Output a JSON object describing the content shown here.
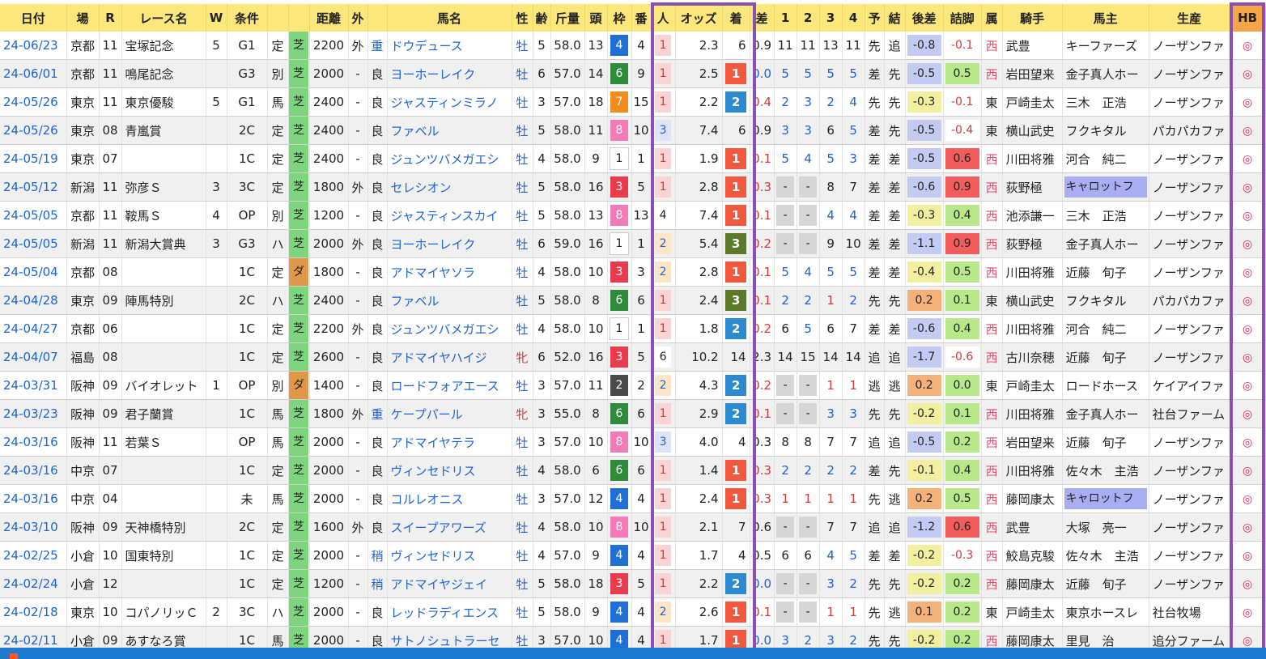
{
  "colors": {
    "header_bg": "#fbe77c",
    "alt_row": "#f0f0f0",
    "link": "#1a64d6",
    "highlight_border": "#8a4fb2",
    "hb_header": "#f4a648",
    "bottom_bar": "#1e7ad0",
    "result_1": "#f2583e",
    "result_2": "#2b8ad0",
    "result_3": "#5a7a2a",
    "turf": "#7dd67d",
    "dirt": "#e0974a",
    "frames": {
      "1": "#ffffff",
      "2": "#4a4a4a",
      "3": "#ea3b4c",
      "4": "#1e6fd6",
      "5": "#f2e64a",
      "6": "#2e8b3a",
      "7": "#f48c1d",
      "8": "#f47ab8"
    }
  },
  "headers": [
    "日付",
    "場",
    "R",
    "レース名",
    "W",
    "条件",
    "",
    "",
    "距離",
    "外",
    "",
    "馬名",
    "性",
    "齢",
    "斤量",
    "頭",
    "枠",
    "番",
    "人",
    "オッズ",
    "着",
    "差",
    "1",
    "2",
    "3",
    "4",
    "予",
    "結",
    "後差",
    "詰脚",
    "属",
    "騎手",
    "馬主",
    "生産",
    "HB"
  ],
  "rows": [
    {
      "date": "24-06/23",
      "place": "京都",
      "r": "11",
      "race": "宝塚記念",
      "w": "5",
      "cls": "G1",
      "cond": "定",
      "track": "芝",
      "dist": "2200",
      "out": "外",
      "going": "重",
      "horse": "ドウデュース",
      "sex": "牡",
      "age": "5",
      "wt": "58.0",
      "heads": "13",
      "frame": "4",
      "num": "4",
      "pop": "1",
      "odds": "2.3",
      "res": "6",
      "diff": "0.9",
      "c1": "11",
      "c2": "11",
      "c3": "13",
      "c4": "11",
      "pred": "先",
      "kekka": "追",
      "kosa": "-0.8",
      "tsume": "-0.1",
      "zoku": "西",
      "jockey": "武豊",
      "owner": "キーファーズ",
      "breeder": "ノーザンファ",
      "hb": "◎"
    },
    {
      "date": "24-06/01",
      "place": "京都",
      "r": "11",
      "race": "鳴尾記念",
      "w": "",
      "cls": "G3",
      "cond": "別",
      "track": "芝",
      "dist": "2000",
      "out": "-",
      "going": "良",
      "horse": "ヨーホーレイク",
      "sex": "牡",
      "age": "6",
      "wt": "57.0",
      "heads": "14",
      "frame": "6",
      "num": "9",
      "pop": "1",
      "odds": "2.5",
      "res": "1",
      "diff": "0.0",
      "c1": "5",
      "c2": "5",
      "c3": "5",
      "c4": "5",
      "pred": "差",
      "kekka": "先",
      "kosa": "-0.5",
      "tsume": "0.5",
      "zoku": "西",
      "jockey": "岩田望来",
      "owner": "金子真人ホー",
      "breeder": "ノーザンファ",
      "hb": "◎"
    },
    {
      "date": "24-05/26",
      "place": "東京",
      "r": "11",
      "race": "東京優駿",
      "w": "5",
      "cls": "G1",
      "cond": "馬",
      "track": "芝",
      "dist": "2400",
      "out": "-",
      "going": "良",
      "horse": "ジャスティンミラノ",
      "sex": "牡",
      "age": "3",
      "wt": "57.0",
      "heads": "18",
      "frame": "7",
      "num": "15",
      "pop": "1",
      "odds": "2.2",
      "res": "2",
      "diff": "0.4",
      "c1": "2",
      "c2": "3",
      "c3": "2",
      "c4": "4",
      "pred": "先",
      "kekka": "先",
      "kosa": "-0.3",
      "tsume": "-0.1",
      "zoku": "東",
      "jockey": "戸崎圭太",
      "owner": "三木　正浩",
      "breeder": "ノーザンファ",
      "hb": "◎"
    },
    {
      "date": "24-05/26",
      "place": "東京",
      "r": "08",
      "race": "青嵐賞",
      "w": "",
      "cls": "2C",
      "cond": "定",
      "track": "芝",
      "dist": "2400",
      "out": "-",
      "going": "良",
      "horse": "ファベル",
      "sex": "牡",
      "age": "5",
      "wt": "58.0",
      "heads": "11",
      "frame": "8",
      "num": "10",
      "pop": "3",
      "odds": "7.4",
      "res": "6",
      "diff": "0.9",
      "c1": "3",
      "c2": "3",
      "c3": "6",
      "c4": "5",
      "pred": "差",
      "kekka": "先",
      "kosa": "-0.5",
      "tsume": "-0.4",
      "zoku": "東",
      "jockey": "横山武史",
      "owner": "フクキタル",
      "breeder": "パカパカファ",
      "hb": "◎"
    },
    {
      "date": "24-05/19",
      "place": "東京",
      "r": "07",
      "race": "",
      "w": "",
      "cls": "1C",
      "cond": "定",
      "track": "芝",
      "dist": "2400",
      "out": "-",
      "going": "良",
      "horse": "ジュンツバメガエシ",
      "sex": "牡",
      "age": "4",
      "wt": "58.0",
      "heads": "9",
      "frame": "1",
      "num": "1",
      "pop": "1",
      "odds": "1.9",
      "res": "1",
      "diff": "0.1",
      "c1": "5",
      "c2": "4",
      "c3": "5",
      "c4": "3",
      "pred": "差",
      "kekka": "差",
      "kosa": "-0.5",
      "tsume": "0.6",
      "zoku": "西",
      "jockey": "川田将雅",
      "owner": "河合　純二",
      "breeder": "ノーザンファ",
      "hb": "◎"
    },
    {
      "date": "24-05/12",
      "place": "新潟",
      "r": "11",
      "race": "弥彦Ｓ",
      "w": "3",
      "cls": "3C",
      "cond": "定",
      "track": "芝",
      "dist": "1800",
      "out": "外",
      "going": "良",
      "horse": "セレシオン",
      "sex": "牡",
      "age": "5",
      "wt": "58.0",
      "heads": "16",
      "frame": "3",
      "num": "5",
      "pop": "1",
      "odds": "2.8",
      "res": "1",
      "diff": "0.3",
      "c1": "-",
      "c2": "-",
      "c3": "8",
      "c4": "7",
      "pred": "差",
      "kekka": "差",
      "kosa": "-0.6",
      "tsume": "0.9",
      "zoku": "西",
      "jockey": "荻野極",
      "owner": "キャロットフ",
      "breeder": "ノーザンファ",
      "hb": "◎"
    },
    {
      "date": "24-05/05",
      "place": "京都",
      "r": "11",
      "race": "鞍馬Ｓ",
      "w": "4",
      "cls": "OP",
      "cond": "別",
      "track": "芝",
      "dist": "1200",
      "out": "-",
      "going": "良",
      "horse": "ジャスティンスカイ",
      "sex": "牡",
      "age": "5",
      "wt": "58.0",
      "heads": "13",
      "frame": "8",
      "num": "13",
      "pop": "4",
      "odds": "7.4",
      "res": "1",
      "diff": "0.1",
      "c1": "-",
      "c2": "-",
      "c3": "4",
      "c4": "4",
      "pred": "差",
      "kekka": "差",
      "kosa": "-0.3",
      "tsume": "0.4",
      "zoku": "西",
      "jockey": "池添謙一",
      "owner": "三木　正浩",
      "breeder": "ノーザンファ",
      "hb": "◎"
    },
    {
      "date": "24-05/05",
      "place": "新潟",
      "r": "11",
      "race": "新潟大賞典",
      "w": "3",
      "cls": "G3",
      "cond": "ハ",
      "track": "芝",
      "dist": "2000",
      "out": "外",
      "going": "良",
      "horse": "ヨーホーレイク",
      "sex": "牡",
      "age": "6",
      "wt": "59.0",
      "heads": "16",
      "frame": "1",
      "num": "1",
      "pop": "2",
      "odds": "5.4",
      "res": "3",
      "diff": "0.2",
      "c1": "-",
      "c2": "-",
      "c3": "9",
      "c4": "10",
      "pred": "差",
      "kekka": "差",
      "kosa": "-1.1",
      "tsume": "0.9",
      "zoku": "西",
      "jockey": "荻野極",
      "owner": "金子真人ホー",
      "breeder": "ノーザンファ",
      "hb": "◎"
    },
    {
      "date": "24-05/04",
      "place": "京都",
      "r": "08",
      "race": "",
      "w": "",
      "cls": "1C",
      "cond": "定",
      "track": "ダ",
      "dist": "1800",
      "out": "-",
      "going": "良",
      "horse": "アドマイヤソラ",
      "sex": "牡",
      "age": "4",
      "wt": "58.0",
      "heads": "10",
      "frame": "3",
      "num": "3",
      "pop": "2",
      "odds": "2.8",
      "res": "1",
      "diff": "0.1",
      "c1": "5",
      "c2": "4",
      "c3": "5",
      "c4": "5",
      "pred": "差",
      "kekka": "差",
      "kosa": "-0.4",
      "tsume": "0.5",
      "zoku": "西",
      "jockey": "川田将雅",
      "owner": "近藤　旬子",
      "breeder": "ノーザンファ",
      "hb": "◎"
    },
    {
      "date": "24-04/28",
      "place": "東京",
      "r": "09",
      "race": "陣馬特別",
      "w": "",
      "cls": "2C",
      "cond": "ハ",
      "track": "芝",
      "dist": "2400",
      "out": "-",
      "going": "良",
      "horse": "ファベル",
      "sex": "牡",
      "age": "5",
      "wt": "58.0",
      "heads": "8",
      "frame": "6",
      "num": "6",
      "pop": "1",
      "odds": "2.4",
      "res": "3",
      "diff": "0.1",
      "c1": "2",
      "c2": "2",
      "c3": "1",
      "c4": "2",
      "pred": "先",
      "kekka": "先",
      "kosa": "0.2",
      "tsume": "0.1",
      "zoku": "東",
      "jockey": "横山武史",
      "owner": "フクキタル",
      "breeder": "パカパカファ",
      "hb": "◎"
    },
    {
      "date": "24-04/27",
      "place": "京都",
      "r": "06",
      "race": "",
      "w": "",
      "cls": "1C",
      "cond": "定",
      "track": "芝",
      "dist": "2200",
      "out": "外",
      "going": "良",
      "horse": "ジュンツバメガエシ",
      "sex": "牡",
      "age": "4",
      "wt": "58.0",
      "heads": "10",
      "frame": "1",
      "num": "1",
      "pop": "1",
      "odds": "1.8",
      "res": "2",
      "diff": "0.2",
      "c1": "6",
      "c2": "5",
      "c3": "6",
      "c4": "7",
      "pred": "差",
      "kekka": "差",
      "kosa": "-0.6",
      "tsume": "0.4",
      "zoku": "西",
      "jockey": "川田将雅",
      "owner": "河合　純二",
      "breeder": "ノーザンファ",
      "hb": "◎"
    },
    {
      "date": "24-04/07",
      "place": "福島",
      "r": "08",
      "race": "",
      "w": "",
      "cls": "1C",
      "cond": "定",
      "track": "芝",
      "dist": "2600",
      "out": "-",
      "going": "良",
      "horse": "アドマイヤハイジ",
      "sex": "牝",
      "age": "6",
      "wt": "52.0",
      "heads": "16",
      "frame": "3",
      "num": "5",
      "pop": "6",
      "odds": "10.2",
      "res": "14",
      "diff": "2.3",
      "c1": "14",
      "c2": "15",
      "c3": "14",
      "c4": "14",
      "pred": "追",
      "kekka": "追",
      "kosa": "-1.7",
      "tsume": "-0.6",
      "zoku": "西",
      "jockey": "古川奈穂",
      "owner": "近藤　旬子",
      "breeder": "ノーザンファ",
      "hb": "◎"
    },
    {
      "date": "24-03/31",
      "place": "阪神",
      "r": "09",
      "race": "バイオレット",
      "w": "1",
      "cls": "OP",
      "cond": "別",
      "track": "ダ",
      "dist": "1400",
      "out": "-",
      "going": "良",
      "horse": "ロードフォアエース",
      "sex": "牡",
      "age": "3",
      "wt": "57.0",
      "heads": "11",
      "frame": "2",
      "num": "2",
      "pop": "2",
      "odds": "4.3",
      "res": "2",
      "diff": "0.2",
      "c1": "-",
      "c2": "-",
      "c3": "1",
      "c4": "1",
      "pred": "逃",
      "kekka": "逃",
      "kosa": "0.2",
      "tsume": "0.0",
      "zoku": "東",
      "jockey": "戸崎圭太",
      "owner": "ロードホース",
      "breeder": "ケイアイファ",
      "hb": "◎"
    },
    {
      "date": "24-03/23",
      "place": "阪神",
      "r": "09",
      "race": "君子蘭賞",
      "w": "",
      "cls": "1C",
      "cond": "馬",
      "track": "芝",
      "dist": "1800",
      "out": "外",
      "going": "重",
      "horse": "ケープパール",
      "sex": "牝",
      "age": "3",
      "wt": "55.0",
      "heads": "8",
      "frame": "6",
      "num": "6",
      "pop": "1",
      "odds": "2.9",
      "res": "2",
      "diff": "0.1",
      "c1": "-",
      "c2": "-",
      "c3": "3",
      "c4": "3",
      "pred": "先",
      "kekka": "先",
      "kosa": "-0.2",
      "tsume": "0.1",
      "zoku": "西",
      "jockey": "川田将雅",
      "owner": "金子真人ホー",
      "breeder": "社台ファーム",
      "hb": "◎"
    },
    {
      "date": "24-03/16",
      "place": "阪神",
      "r": "11",
      "race": "若葉Ｓ",
      "w": "",
      "cls": "OP",
      "cond": "馬",
      "track": "芝",
      "dist": "2000",
      "out": "-",
      "going": "良",
      "horse": "アドマイヤテラ",
      "sex": "牡",
      "age": "3",
      "wt": "57.0",
      "heads": "10",
      "frame": "8",
      "num": "10",
      "pop": "3",
      "odds": "4.0",
      "res": "4",
      "diff": "0.3",
      "c1": "8",
      "c2": "8",
      "c3": "7",
      "c4": "7",
      "pred": "追",
      "kekka": "追",
      "kosa": "-0.5",
      "tsume": "0.2",
      "zoku": "西",
      "jockey": "岩田望来",
      "owner": "近藤　旬子",
      "breeder": "ノーザンファ",
      "hb": "◎"
    },
    {
      "date": "24-03/16",
      "place": "中京",
      "r": "07",
      "race": "",
      "w": "",
      "cls": "1C",
      "cond": "定",
      "track": "芝",
      "dist": "2000",
      "out": "-",
      "going": "良",
      "horse": "ヴィンセドリス",
      "sex": "牡",
      "age": "4",
      "wt": "58.0",
      "heads": "6",
      "frame": "6",
      "num": "6",
      "pop": "1",
      "odds": "1.4",
      "res": "1",
      "diff": "0.3",
      "c1": "2",
      "c2": "2",
      "c3": "2",
      "c4": "2",
      "pred": "差",
      "kekka": "先",
      "kosa": "-0.1",
      "tsume": "0.4",
      "zoku": "西",
      "jockey": "川田将雅",
      "owner": "佐々木　主浩",
      "breeder": "ノーザンファ",
      "hb": "◎"
    },
    {
      "date": "24-03/16",
      "place": "中京",
      "r": "04",
      "race": "",
      "w": "",
      "cls": "未",
      "cond": "馬",
      "track": "芝",
      "dist": "2000",
      "out": "-",
      "going": "良",
      "horse": "コルレオニス",
      "sex": "牡",
      "age": "3",
      "wt": "57.0",
      "heads": "12",
      "frame": "4",
      "num": "4",
      "pop": "1",
      "odds": "2.4",
      "res": "1",
      "diff": "0.3",
      "c1": "1",
      "c2": "1",
      "c3": "1",
      "c4": "1",
      "pred": "先",
      "kekka": "逃",
      "kosa": "0.2",
      "tsume": "0.5",
      "zoku": "西",
      "jockey": "藤岡康太",
      "owner": "キャロットフ",
      "breeder": "ノーザンファ",
      "hb": "◎"
    },
    {
      "date": "24-03/10",
      "place": "阪神",
      "r": "09",
      "race": "天神橋特別",
      "w": "",
      "cls": "2C",
      "cond": "定",
      "track": "芝",
      "dist": "1600",
      "out": "外",
      "going": "良",
      "horse": "スイープアワーズ",
      "sex": "牡",
      "age": "4",
      "wt": "58.0",
      "heads": "10",
      "frame": "8",
      "num": "10",
      "pop": "1",
      "odds": "2.1",
      "res": "7",
      "diff": "0.6",
      "c1": "-",
      "c2": "-",
      "c3": "7",
      "c4": "7",
      "pred": "追",
      "kekka": "追",
      "kosa": "-1.2",
      "tsume": "0.6",
      "zoku": "西",
      "jockey": "武豊",
      "owner": "大塚　亮一",
      "breeder": "ノーザンファ",
      "hb": "◎"
    },
    {
      "date": "24-02/25",
      "place": "小倉",
      "r": "10",
      "race": "国東特別",
      "w": "",
      "cls": "1C",
      "cond": "定",
      "track": "芝",
      "dist": "2000",
      "out": "-",
      "going": "稍",
      "horse": "ヴィンセドリス",
      "sex": "牡",
      "age": "4",
      "wt": "57.0",
      "heads": "9",
      "frame": "4",
      "num": "4",
      "pop": "1",
      "odds": "1.7",
      "res": "4",
      "diff": "0.5",
      "c1": "6",
      "c2": "6",
      "c3": "4",
      "c4": "5",
      "pred": "差",
      "kekka": "差",
      "kosa": "-0.2",
      "tsume": "-0.3",
      "zoku": "西",
      "jockey": "鮫島克駿",
      "owner": "佐々木　主浩",
      "breeder": "ノーザンファ",
      "hb": "◎"
    },
    {
      "date": "24-02/24",
      "place": "小倉",
      "r": "12",
      "race": "",
      "w": "",
      "cls": "1C",
      "cond": "定",
      "track": "芝",
      "dist": "1200",
      "out": "-",
      "going": "稍",
      "horse": "アドマイヤジェイ",
      "sex": "牡",
      "age": "5",
      "wt": "58.0",
      "heads": "18",
      "frame": "3",
      "num": "5",
      "pop": "1",
      "odds": "2.2",
      "res": "2",
      "diff": "0.0",
      "c1": "-",
      "c2": "-",
      "c3": "3",
      "c4": "2",
      "pred": "先",
      "kekka": "先",
      "kosa": "-0.2",
      "tsume": "0.2",
      "zoku": "西",
      "jockey": "藤岡康太",
      "owner": "近藤　旬子",
      "breeder": "ノーザンファ",
      "hb": "◎"
    },
    {
      "date": "24-02/18",
      "place": "東京",
      "r": "10",
      "race": "コパノリッ​Ｃ",
      "w": "2",
      "cls": "3C",
      "cond": "ハ",
      "track": "芝",
      "dist": "2000",
      "out": "-",
      "going": "良",
      "horse": "レッドラディエンス",
      "sex": "牡",
      "age": "5",
      "wt": "58.0",
      "heads": "9",
      "frame": "4",
      "num": "4",
      "pop": "2",
      "odds": "2.6",
      "res": "1",
      "diff": "0.1",
      "c1": "-",
      "c2": "-",
      "c3": "1",
      "c4": "1",
      "pred": "先",
      "kekka": "逃",
      "kosa": "0.1",
      "tsume": "0.2",
      "zoku": "東",
      "jockey": "戸崎圭太",
      "owner": "東京ホースレ",
      "breeder": "社台牧場",
      "hb": "◎"
    },
    {
      "date": "24-02/11",
      "place": "小倉",
      "r": "09",
      "race": "あすなろ賞",
      "w": "",
      "cls": "1C",
      "cond": "馬",
      "track": "芝",
      "dist": "2000",
      "out": "-",
      "going": "良",
      "horse": "サトノシュトラーセ",
      "sex": "牡",
      "age": "3",
      "wt": "57.0",
      "heads": "10",
      "frame": "4",
      "num": "4",
      "pop": "1",
      "odds": "1.7",
      "res": "1",
      "diff": "0.0",
      "c1": "3",
      "c2": "2",
      "c3": "3",
      "c4": "2",
      "pred": "先",
      "kekka": "先",
      "kosa": "-0.2",
      "tsume": "0.2",
      "zoku": "西",
      "jockey": "藤岡康太",
      "owner": "里見　治",
      "breeder": "追分ファーム",
      "hb": "◎"
    }
  ]
}
